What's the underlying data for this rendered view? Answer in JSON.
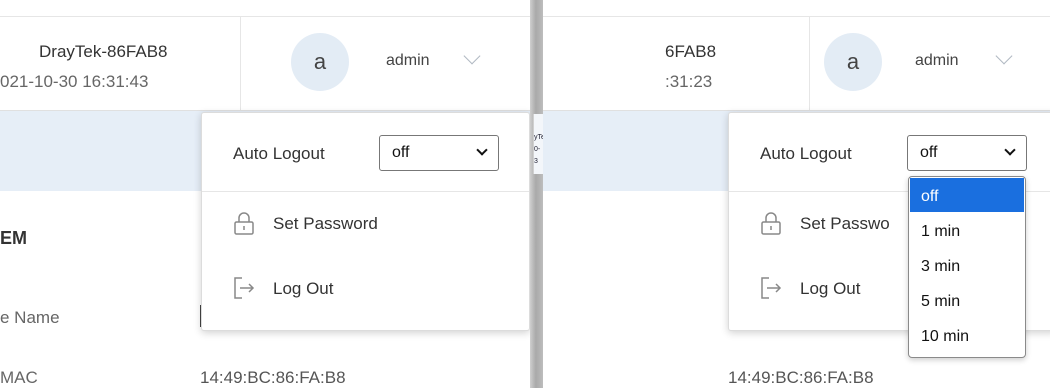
{
  "left": {
    "header": {
      "device_name": "DrayTek-86FAB8",
      "datetime": "021-10-30 16:31:43",
      "avatar_initial": "a",
      "username": "admin"
    },
    "content": {
      "section_title": "EM",
      "device_name_label": "e Name",
      "mac_label": "MAC",
      "mac_value": "14:49:BC:86:FA:B8"
    },
    "mini_window": {
      "line1": "yTe",
      "line2": "0-3"
    },
    "menu": {
      "auto_logout_label": "Auto Logout",
      "auto_logout_value": "off",
      "set_password": "Set Password",
      "log_out": "Log Out"
    }
  },
  "right": {
    "header": {
      "device_name": "6FAB8",
      "datetime": ":31:23",
      "avatar_initial": "a",
      "username": "admin"
    },
    "content": {
      "mac_value": "14:49:BC:86:FA:B8"
    },
    "menu": {
      "auto_logout_label": "Auto Logout",
      "auto_logout_value": "off",
      "set_password": "Set Passwo",
      "log_out": "Log Out"
    },
    "select_options": [
      "off",
      "1 min",
      "3 min",
      "5 min",
      "10 min"
    ],
    "selected_index": 0
  },
  "colors": {
    "accent": "#1a6fdf",
    "avatar_bg": "#e3ecf5",
    "band_bg": "#e6eef7"
  },
  "icons": {
    "lock": "lock-icon",
    "logout": "logout-icon",
    "chevron": "chevron-down-icon"
  }
}
